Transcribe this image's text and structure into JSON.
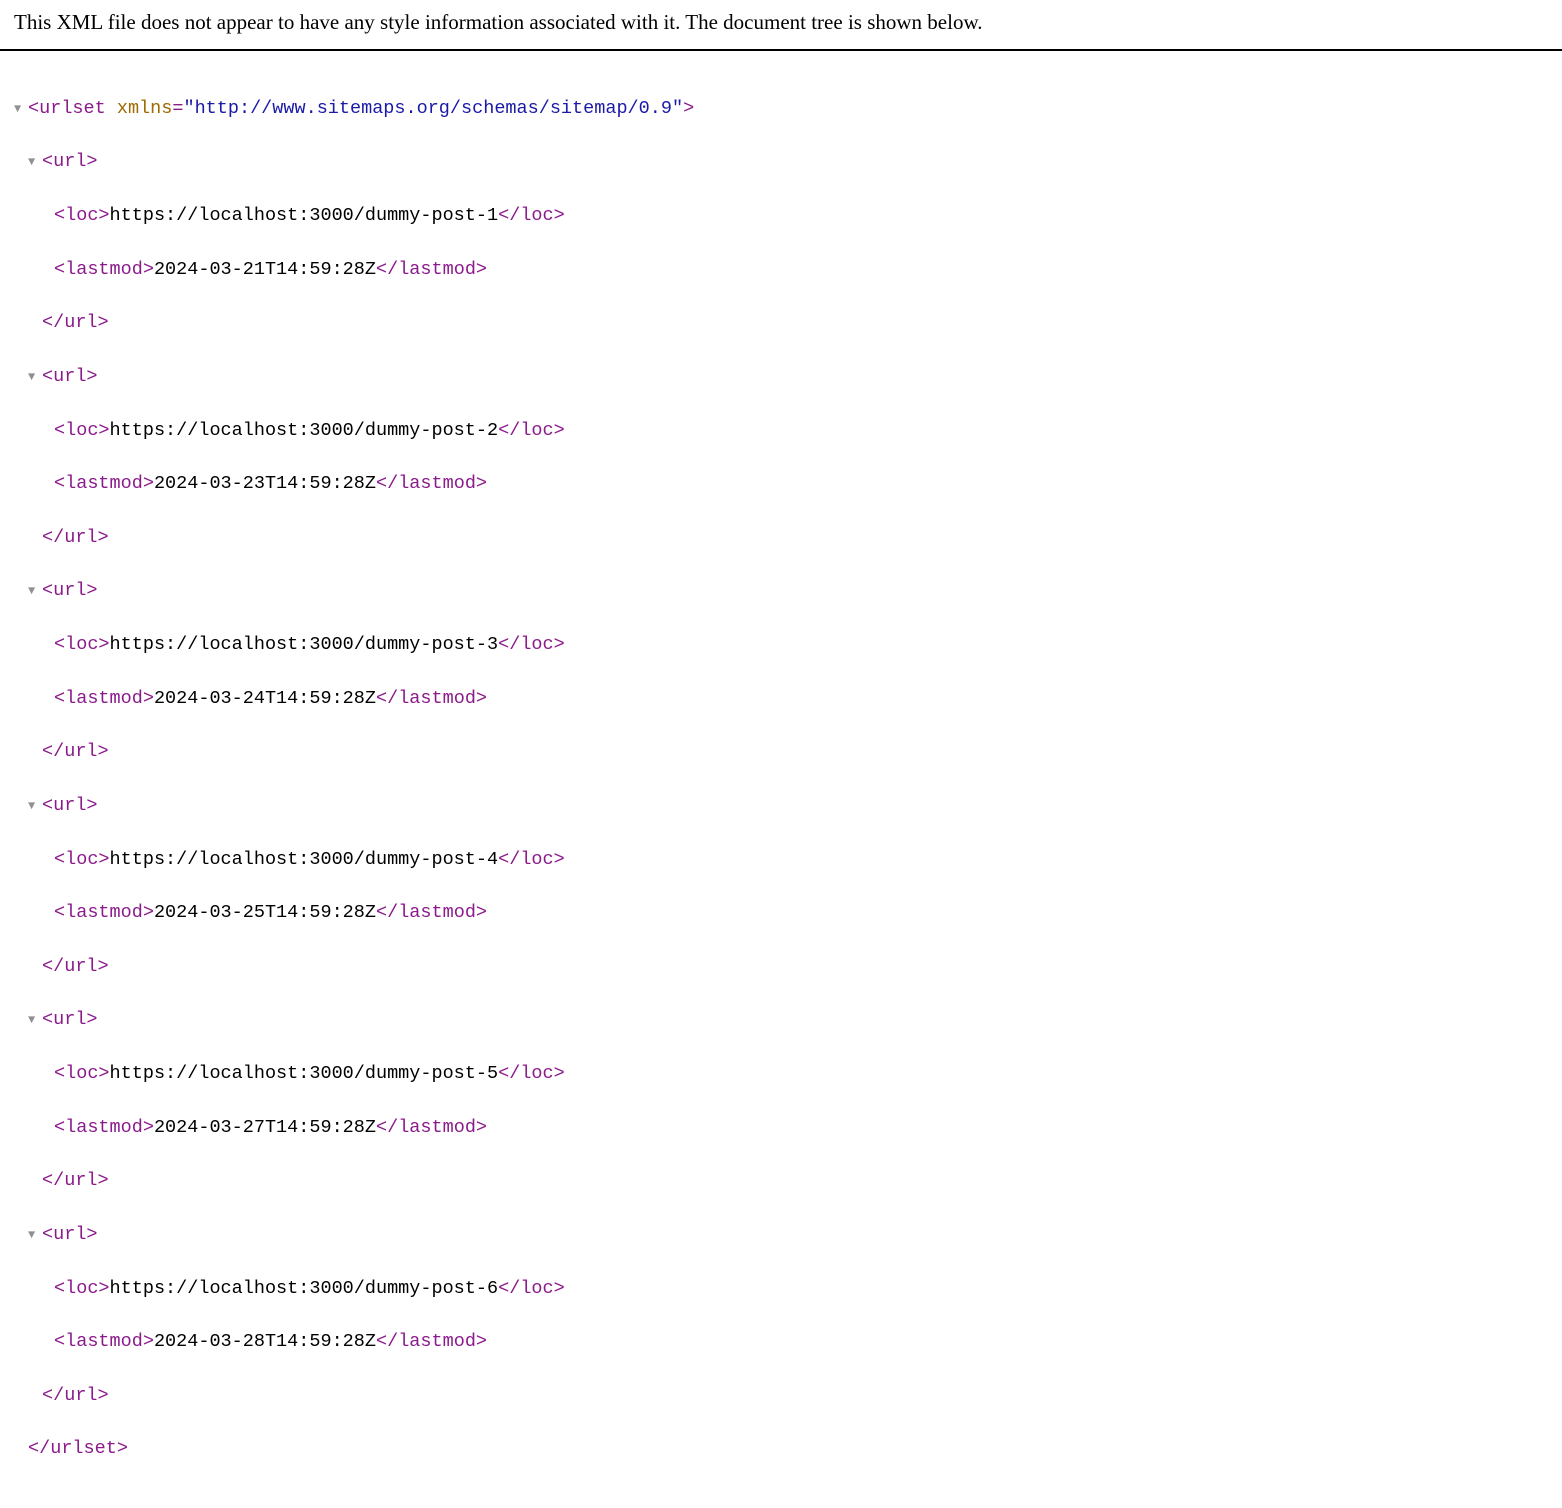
{
  "notice": "This XML file does not appear to have any style information associated with it. The document tree is shown below.",
  "xml": {
    "root": {
      "tag": "urlset",
      "attrName": "xmlns",
      "attrValue": "\"http://www.sitemaps.org/schemas/sitemap/0.9\""
    },
    "urls": [
      {
        "loc": "https://localhost:3000/dummy-post-1",
        "lastmod": "2024-03-21T14:59:28Z"
      },
      {
        "loc": "https://localhost:3000/dummy-post-2",
        "lastmod": "2024-03-23T14:59:28Z"
      },
      {
        "loc": "https://localhost:3000/dummy-post-3",
        "lastmod": "2024-03-24T14:59:28Z"
      },
      {
        "loc": "https://localhost:3000/dummy-post-4",
        "lastmod": "2024-03-25T14:59:28Z"
      },
      {
        "loc": "https://localhost:3000/dummy-post-5",
        "lastmod": "2024-03-27T14:59:28Z"
      },
      {
        "loc": "https://localhost:3000/dummy-post-6",
        "lastmod": "2024-03-28T14:59:28Z"
      }
    ],
    "tags": {
      "url": "url",
      "loc": "loc",
      "lastmod": "lastmod"
    },
    "glyphs": {
      "triangle": "▼",
      "lt": "<",
      "gt": ">",
      "ltSlash": "</",
      "eq": "="
    }
  }
}
